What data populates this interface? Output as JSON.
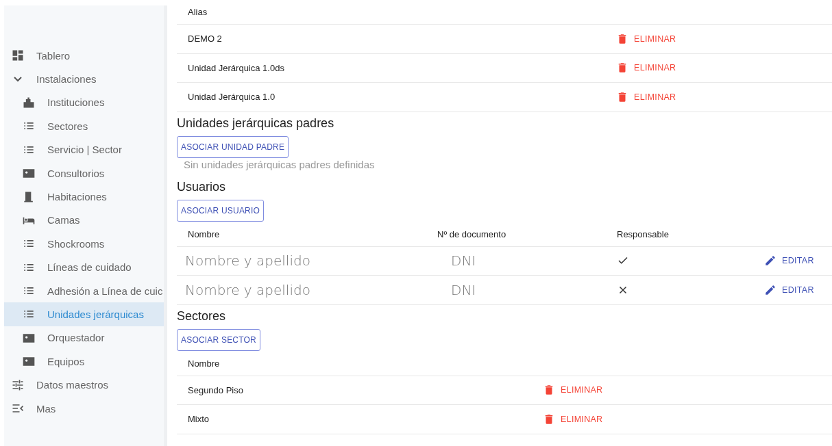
{
  "sidebar": {
    "items": [
      {
        "kind": "dashboard",
        "label": "Tablero",
        "selected": false
      },
      {
        "kind": "group",
        "label": "Instalaciones",
        "selected": false,
        "expanded": true,
        "children": [
          {
            "kind": "building",
            "label": "Instituciones",
            "selected": false
          },
          {
            "kind": "list",
            "label": "Sectores",
            "selected": false
          },
          {
            "kind": "list",
            "label": "Servicio | Sector",
            "selected": false
          },
          {
            "kind": "card",
            "label": "Consultorios",
            "selected": false
          },
          {
            "kind": "door",
            "label": "Habitaciones",
            "selected": false
          },
          {
            "kind": "bed",
            "label": "Camas",
            "selected": false
          },
          {
            "kind": "list",
            "label": "Shockrooms",
            "selected": false
          },
          {
            "kind": "list",
            "label": "Líneas de cuidado",
            "selected": false
          },
          {
            "kind": "list",
            "label": "Adhesión a Línea de cuic",
            "selected": false
          },
          {
            "kind": "list",
            "label": "Unidades jerárquicas",
            "selected": true
          },
          {
            "kind": "card",
            "label": "Orquestador",
            "selected": false
          },
          {
            "kind": "card",
            "label": "Equipos",
            "selected": false
          }
        ]
      },
      {
        "kind": "tune",
        "label": "Datos maestros",
        "selected": false
      },
      {
        "kind": "more",
        "label": "Mas",
        "selected": false
      }
    ]
  },
  "alias_table": {
    "columns": [
      "Alias"
    ],
    "rows": [
      {
        "alias": "DEMO 2",
        "action": "ELIMINAR"
      },
      {
        "alias": "Unidad Jerárquica 1.0ds",
        "action": "ELIMINAR"
      },
      {
        "alias": "Unidad Jerárquica 1.0",
        "action": "ELIMINAR"
      }
    ]
  },
  "parents": {
    "title": "Unidades jerárquicas padres",
    "button": "ASOCIAR UNIDAD PADRE",
    "empty_text": "Sin unidades jerárquicas padres definidas"
  },
  "users": {
    "title": "Usuarios",
    "button": "ASOCIAR USUARIO",
    "columns": [
      "Nombre",
      "Nº de documento",
      "Responsable"
    ],
    "rows": [
      {
        "name": "Nombre y apellido",
        "document": "DNI",
        "responsible": true,
        "action": "EDITAR"
      },
      {
        "name": "Nombre y apellido",
        "document": "DNI",
        "responsible": false,
        "action": "EDITAR"
      }
    ]
  },
  "sectors": {
    "title": "Sectores",
    "button": "ASOCIAR SECTOR",
    "columns": [
      "Nombre"
    ],
    "rows": [
      {
        "name": "Segundo Piso",
        "action": "ELIMINAR"
      },
      {
        "name": "Mixto",
        "action": "ELIMINAR"
      }
    ]
  }
}
